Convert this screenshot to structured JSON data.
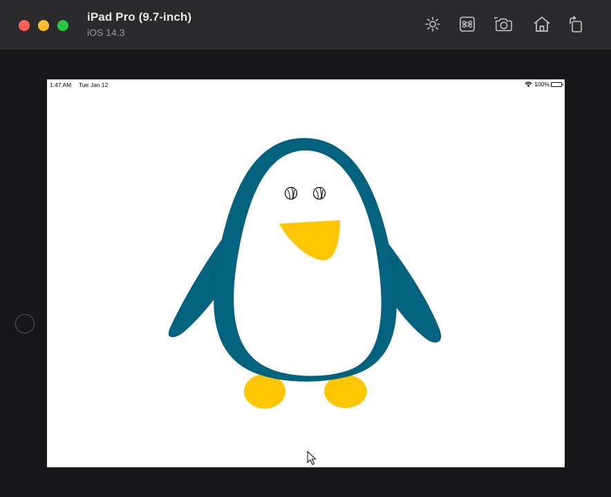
{
  "window": {
    "device_name": "iPad Pro (9.7-inch)",
    "os_version": "iOS 14.3",
    "toolbar": [
      {
        "icon": "brightness-icon",
        "label": "Toggle Appearance"
      },
      {
        "icon": "command-icon",
        "label": "Keyboard Shortcuts"
      },
      {
        "icon": "camera-icon",
        "label": "Screenshot"
      },
      {
        "icon": "home-icon",
        "label": "Home"
      },
      {
        "icon": "rotate-icon",
        "label": "Rotate"
      }
    ]
  },
  "status_bar": {
    "time": "1:47 AM",
    "date": "Tue Jan 12",
    "battery": "100%"
  },
  "colors": {
    "penguin_body": "#03627e",
    "penguin_belly": "#ffffff",
    "penguin_beak": "#fec503",
    "penguin_feet": "#fec503"
  }
}
